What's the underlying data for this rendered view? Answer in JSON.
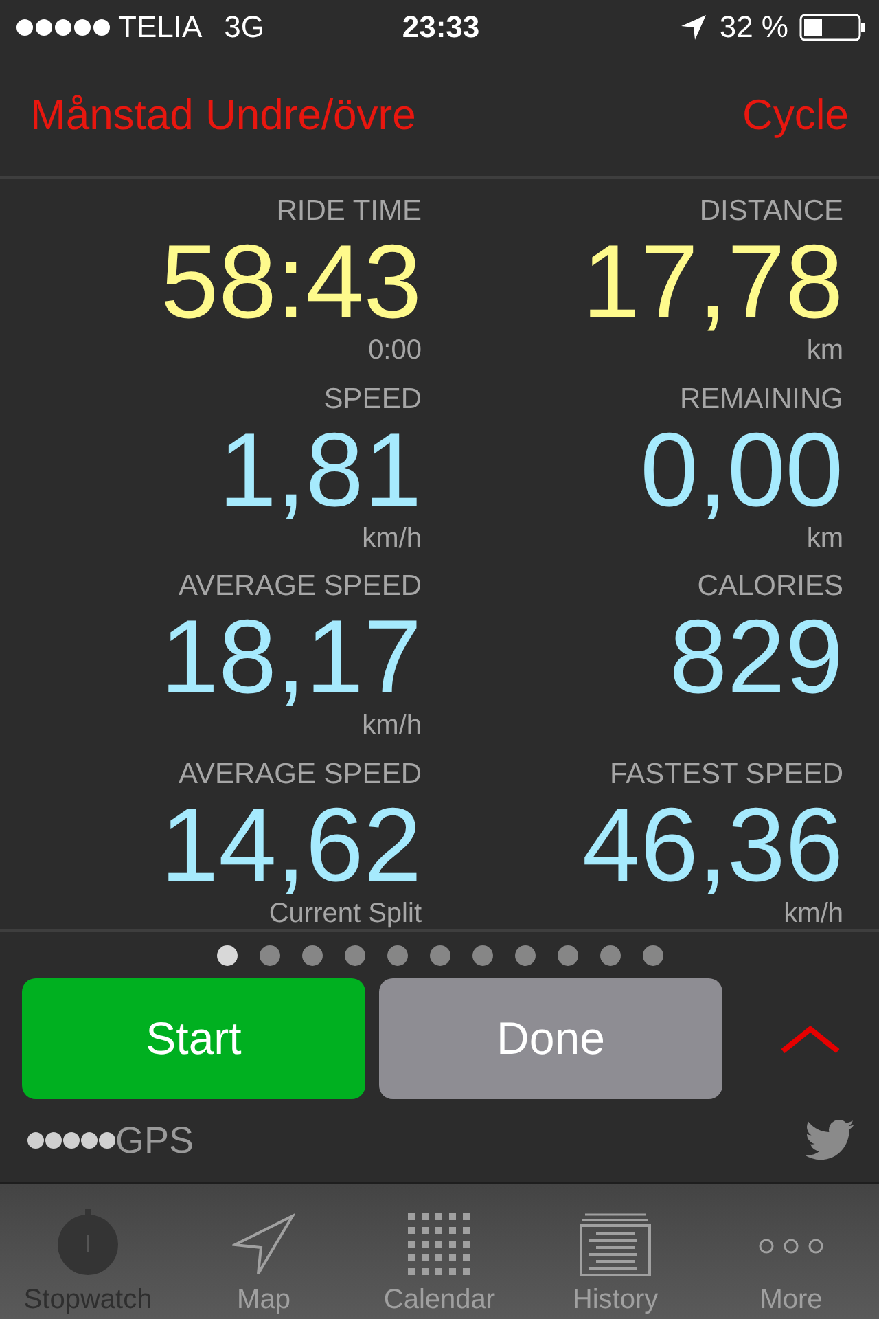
{
  "status_bar": {
    "carrier": "TELIA",
    "network": "3G",
    "time": "23:33",
    "battery": "32 %"
  },
  "nav": {
    "title": "Månstad Undre/övre",
    "action": "Cycle"
  },
  "stats": [
    {
      "label": "RIDE TIME",
      "value": "58:43",
      "unit": "0:00",
      "kind": "highlight"
    },
    {
      "label": "DISTANCE",
      "value": "17,78",
      "unit": "km",
      "kind": "highlight"
    },
    {
      "label": "SPEED",
      "value": "1,81",
      "unit": "km/h",
      "kind": "normal"
    },
    {
      "label": "REMAINING",
      "value": "0,00",
      "unit": "km",
      "kind": "normal"
    },
    {
      "label": "AVERAGE SPEED",
      "value": "18,17",
      "unit": "km/h",
      "kind": "normal"
    },
    {
      "label": "CALORIES",
      "value": "829",
      "kind": "normal"
    },
    {
      "label": "AVERAGE SPEED",
      "value": "14,62",
      "unit": "Current Split",
      "kind": "normal"
    },
    {
      "label": "FASTEST SPEED",
      "value": "46,36",
      "unit": "km/h",
      "kind": "normal"
    }
  ],
  "pages": [
    {
      "selected": true
    },
    {
      "selected": false
    },
    {
      "selected": false
    },
    {
      "selected": false
    },
    {
      "selected": false
    },
    {
      "selected": false
    },
    {
      "selected": false
    },
    {
      "selected": false
    },
    {
      "selected": false
    },
    {
      "selected": false
    },
    {
      "selected": false
    }
  ],
  "buttons": [
    {
      "label": "Start",
      "kind": "start"
    },
    {
      "label": "Done",
      "kind": "done"
    }
  ],
  "gps_label": "GPS",
  "tabs": [
    {
      "label": "Stopwatch",
      "selected": true,
      "kind": "stopwatch"
    },
    {
      "label": "Map",
      "selected": false,
      "kind": "map"
    },
    {
      "label": "Calendar",
      "selected": false,
      "kind": "calendar"
    },
    {
      "label": "History",
      "selected": false,
      "kind": "history"
    },
    {
      "label": "More",
      "selected": false,
      "kind": "more"
    }
  ]
}
